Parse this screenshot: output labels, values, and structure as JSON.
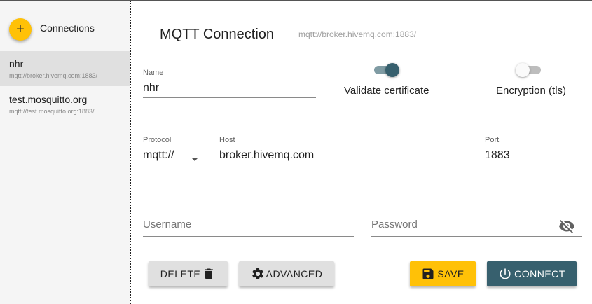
{
  "sidebar": {
    "add_icon": "plus-icon",
    "title": "Connections",
    "items": [
      {
        "name": "nhr",
        "url": "mqtt://broker.hivemq.com:1883/",
        "active": true
      },
      {
        "name": "test.mosquitto.org",
        "url": "mqtt://test.mosquitto.org:1883/",
        "active": false
      }
    ]
  },
  "main": {
    "title": "MQTT Connection",
    "url": "mqtt://broker.hivemq.com:1883/",
    "name_field": {
      "label": "Name",
      "value": "nhr"
    },
    "validate_certificate": {
      "label": "Validate certificate",
      "on": true
    },
    "encryption": {
      "label": "Encryption (tls)",
      "on": false
    },
    "protocol_field": {
      "label": "Protocol",
      "value": "mqtt://"
    },
    "host_field": {
      "label": "Host",
      "value": "broker.hivemq.com"
    },
    "port_field": {
      "label": "Port",
      "value": "1883"
    },
    "username_field": {
      "placeholder": "Username"
    },
    "password_field": {
      "placeholder": "Password",
      "icon": "eye-off-icon"
    },
    "buttons": {
      "delete": "DELETE",
      "advanced": "ADVANCED",
      "save": "SAVE",
      "connect": "CONNECT"
    }
  },
  "colors": {
    "accent": "#ffc107",
    "primary": "#37606e",
    "sidebar_bg": "#f5f5f5",
    "active_item_bg": "#e0e0e0"
  }
}
